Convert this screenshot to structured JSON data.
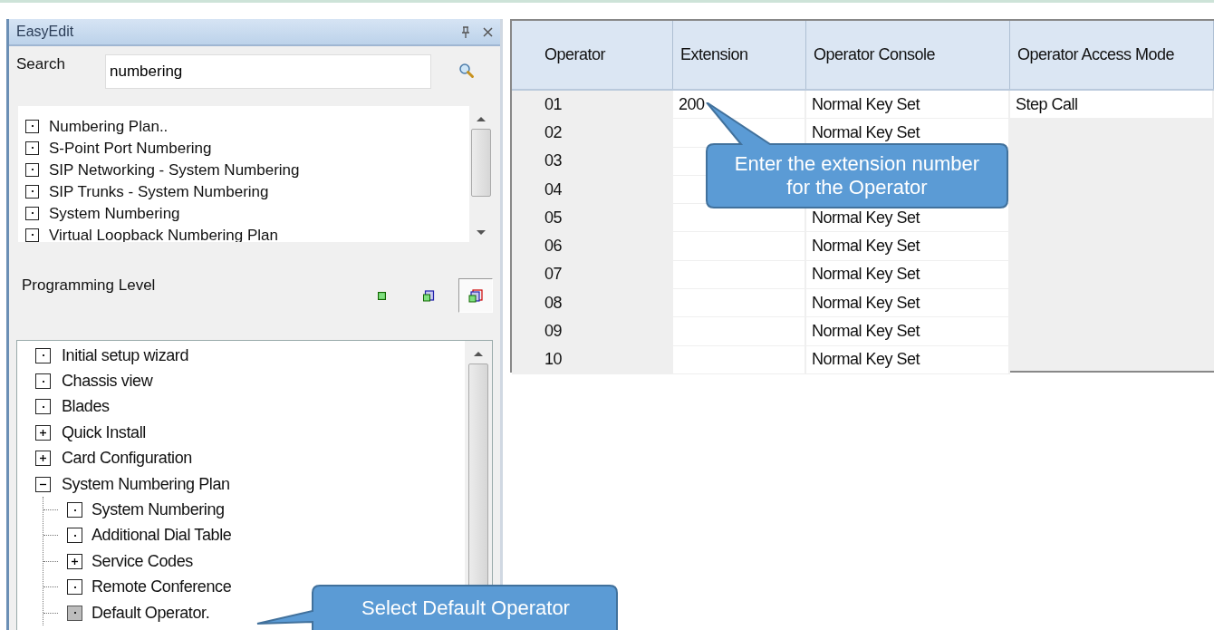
{
  "panel": {
    "title": "EasyEdit",
    "search": {
      "label": "Search",
      "value": "numbering"
    },
    "results": [
      {
        "label": "Numbering Plan.."
      },
      {
        "label": "S-Point Port Numbering"
      },
      {
        "label": "SIP Networking - System Numbering"
      },
      {
        "label": "SIP Trunks - System Numbering"
      },
      {
        "label": "System Numbering"
      },
      {
        "label": "Virtual Loopback Numbering Plan"
      }
    ],
    "programming_level": {
      "label": "Programming Level",
      "levels": [
        {
          "kind": "basic",
          "selected": false
        },
        {
          "kind": "intermediate",
          "selected": false
        },
        {
          "kind": "advanced",
          "selected": true
        }
      ]
    },
    "tree": [
      {
        "label": "Initial setup wizard",
        "kind": "leaf",
        "selected": false
      },
      {
        "label": "Chassis view",
        "kind": "leaf",
        "selected": false
      },
      {
        "label": "Blades",
        "kind": "leaf",
        "selected": false
      },
      {
        "label": "Quick Install",
        "kind": "folder",
        "expanded": false,
        "selected": false
      },
      {
        "label": "Card Configuration",
        "kind": "folder",
        "expanded": false,
        "selected": false
      },
      {
        "label": "System Numbering Plan",
        "kind": "folder",
        "expanded": true,
        "selected": false,
        "children": [
          {
            "label": "System Numbering",
            "kind": "leaf",
            "selected": false
          },
          {
            "label": "Additional Dial Table",
            "kind": "leaf",
            "selected": false
          },
          {
            "label": "Service Codes",
            "kind": "folder",
            "expanded": false,
            "selected": false
          },
          {
            "label": "Remote Conference",
            "kind": "leaf",
            "selected": false
          },
          {
            "label": "Default Operator.",
            "kind": "leaf",
            "selected": true
          }
        ]
      }
    ]
  },
  "table": {
    "columns": [
      "Operator",
      "Extension",
      "Operator Console",
      "Operator Access Mode"
    ],
    "rows": [
      [
        "01",
        "200",
        "Normal Key Set",
        "Step Call"
      ],
      [
        "02",
        "",
        "Normal Key Set",
        null
      ],
      [
        "03",
        "",
        "",
        null
      ],
      [
        "04",
        "",
        "",
        null
      ],
      [
        "05",
        "",
        "Normal Key Set",
        null
      ],
      [
        "06",
        "",
        "Normal Key Set",
        null
      ],
      [
        "07",
        "",
        "Normal Key Set",
        null
      ],
      [
        "08",
        "",
        "Normal Key Set",
        null
      ],
      [
        "09",
        "",
        "Normal Key Set",
        null
      ],
      [
        "10",
        "",
        "Normal Key Set",
        null
      ]
    ]
  },
  "callouts": [
    {
      "kind": "grid",
      "text": "Enter the extension number for the Operator"
    },
    {
      "kind": "tree",
      "text": "Select Default Operator"
    }
  ]
}
